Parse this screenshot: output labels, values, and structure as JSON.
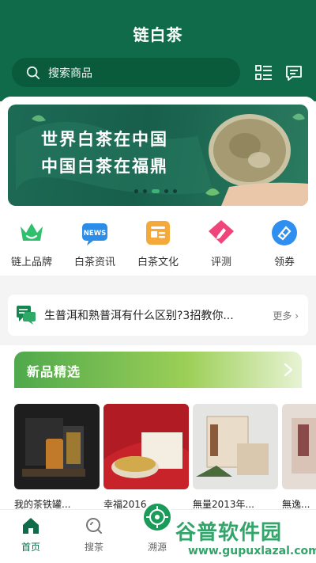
{
  "app": {
    "title": "链白茶"
  },
  "search": {
    "placeholder": "搜索商品"
  },
  "banner": {
    "line1": "世界白茶在中国",
    "line2": "中国白茶在福鼎",
    "active_dot": 3,
    "dot_count": 5
  },
  "nav": {
    "items": [
      {
        "label": "链上品牌",
        "icon": "crown-icon"
      },
      {
        "label": "白茶资讯",
        "icon": "news-icon",
        "badge": "NEWS"
      },
      {
        "label": "白茶文化",
        "icon": "document-icon"
      },
      {
        "label": "评测",
        "icon": "pencil-tag-icon"
      },
      {
        "label": "领券",
        "icon": "coupon-icon"
      }
    ]
  },
  "qa": {
    "text": "生普洱和熟普洱有什么区别?3招教你...",
    "more": "更多"
  },
  "new_products": {
    "title": "新品精选",
    "items": [
      {
        "name": "我的茶铁罐..."
      },
      {
        "name": "幸福2016..."
      },
      {
        "name": "無量2013年..."
      },
      {
        "name": "無逸..."
      }
    ]
  },
  "tabs": [
    {
      "label": "首页",
      "icon": "home-icon",
      "active": true
    },
    {
      "label": "搜茶",
      "icon": "search-icon",
      "active": false
    },
    {
      "label": "溯源",
      "icon": "target-icon",
      "active": false
    }
  ],
  "watermark": {
    "main": "谷普软件园",
    "url": "www.gupuxlazal.com"
  },
  "colors": {
    "brand": "#0f6b49",
    "accent": "#3cb275"
  }
}
